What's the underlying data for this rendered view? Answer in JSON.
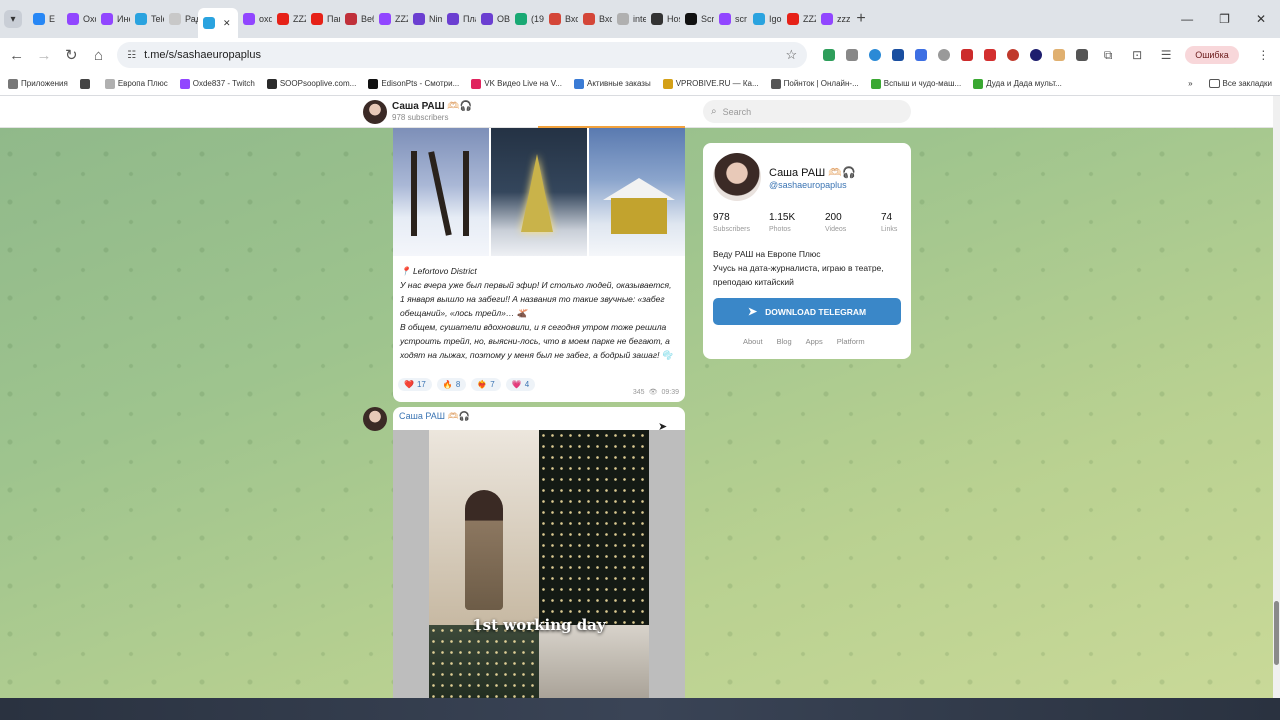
{
  "browser": {
    "tabs": [
      {
        "label": "Е",
        "color": "#2787f5"
      },
      {
        "label": "Oxd",
        "color": "#9146ff"
      },
      {
        "label": "Инє",
        "color": "#9146ff"
      },
      {
        "label": "Tele",
        "color": "#2aa3df"
      },
      {
        "label": "Рад",
        "color": "#c8c8c8"
      },
      {
        "label": "",
        "color": "#2aa3df",
        "active": true
      },
      {
        "label": "oxd",
        "color": "#9146ff"
      },
      {
        "label": "ZZZ",
        "color": "#e62117"
      },
      {
        "label": "Пан",
        "color": "#e62117"
      },
      {
        "label": "Веб",
        "color": "#c0303a"
      },
      {
        "label": "ZZZ",
        "color": "#9146ff"
      },
      {
        "label": "Nim",
        "color": "#6b3fd1"
      },
      {
        "label": "Пла",
        "color": "#6b3fd1"
      },
      {
        "label": "OBS",
        "color": "#6b3fd1"
      },
      {
        "label": "(19)",
        "color": "#19a974"
      },
      {
        "label": "Вхо",
        "color": "#d44638"
      },
      {
        "label": "Вхо",
        "color": "#d44638"
      },
      {
        "label": "inte",
        "color": "#b0b0b0"
      },
      {
        "label": "Hos",
        "color": "#333333"
      },
      {
        "label": "Scr",
        "color": "#111111"
      },
      {
        "label": "scr",
        "color": "#9146ff"
      },
      {
        "label": "Igor",
        "color": "#2aa3df"
      },
      {
        "label": "ZZZ",
        "color": "#e62117"
      },
      {
        "label": "zzz",
        "color": "#9146ff"
      }
    ],
    "url": "t.me/s/sashaeuropaplus",
    "error_label": "Ошибка",
    "bookmarks": [
      {
        "label": "Приложения",
        "color": "#777777"
      },
      {
        "label": "",
        "color": "#444444"
      },
      {
        "label": "Европа Плюс",
        "color": "#b0b0b0"
      },
      {
        "label": "Oxde837 - Twitch",
        "color": "#9146ff"
      },
      {
        "label": "SOOPsooplive.com...",
        "color": "#2a2a2a"
      },
      {
        "label": "EdisonPts - Смотри...",
        "color": "#111111"
      },
      {
        "label": "VK Видео Live на V...",
        "color": "#e0245e"
      },
      {
        "label": "Активные заказы",
        "color": "#3a7bd5"
      },
      {
        "label": "VPROBIVE.RU — Ка...",
        "color": "#d4a017"
      },
      {
        "label": "Пойнток | Онлайн-...",
        "color": "#555555"
      },
      {
        "label": "Вспыш и чудо-маш...",
        "color": "#3aa832"
      },
      {
        "label": "Дуда и Дада мульт...",
        "color": "#3aa832"
      }
    ],
    "all_bookmarks": "Все закладки"
  },
  "channel": {
    "name": "Саша РАШ 🫶🏻🎧",
    "subscribers_label": "978 subscribers",
    "search_placeholder": "Search"
  },
  "post1": {
    "location": "📍 Lefortovo District",
    "text": "У нас вчера уже был первый эфир! И столько людей, оказывается, 1 января вышло на забеги!! А названия то такие звучные: «забег обещаний», «лось трейл»… 🫎\nВ общем, сушатели вдохновили, и я сегодня утром тоже решила устроить трейл, но, выясни-лось, что в моем парке не бегают, а ходят на лыжах, поэтому у меня был не забег, а бодрый зашаг! 🫧",
    "reactions": [
      {
        "emoji": "❤️",
        "count": "17"
      },
      {
        "emoji": "🔥",
        "count": "8"
      },
      {
        "emoji": "❤️‍🔥",
        "count": "7"
      },
      {
        "emoji": "💗",
        "count": "4"
      }
    ],
    "views": "345",
    "time": "09:39"
  },
  "post2": {
    "author": "Саша РАШ 🫶🏻🎧",
    "video_caption": "1st working day"
  },
  "profile": {
    "name": "Саша РАШ 🫶🏻🎧",
    "handle": "@sashaeuropaplus",
    "stats": [
      {
        "value": "978",
        "label": "Subscribers"
      },
      {
        "value": "1.15K",
        "label": "Photos"
      },
      {
        "value": "200",
        "label": "Videos"
      },
      {
        "value": "74",
        "label": "Links"
      }
    ],
    "description": "Веду РАШ на Европе Плюс\nУчусь на дата-журналиста, играю в театре, преподаю китайский",
    "download_label": "DOWNLOAD TELEGRAM",
    "links": [
      "About",
      "Blog",
      "Apps",
      "Platform"
    ]
  }
}
